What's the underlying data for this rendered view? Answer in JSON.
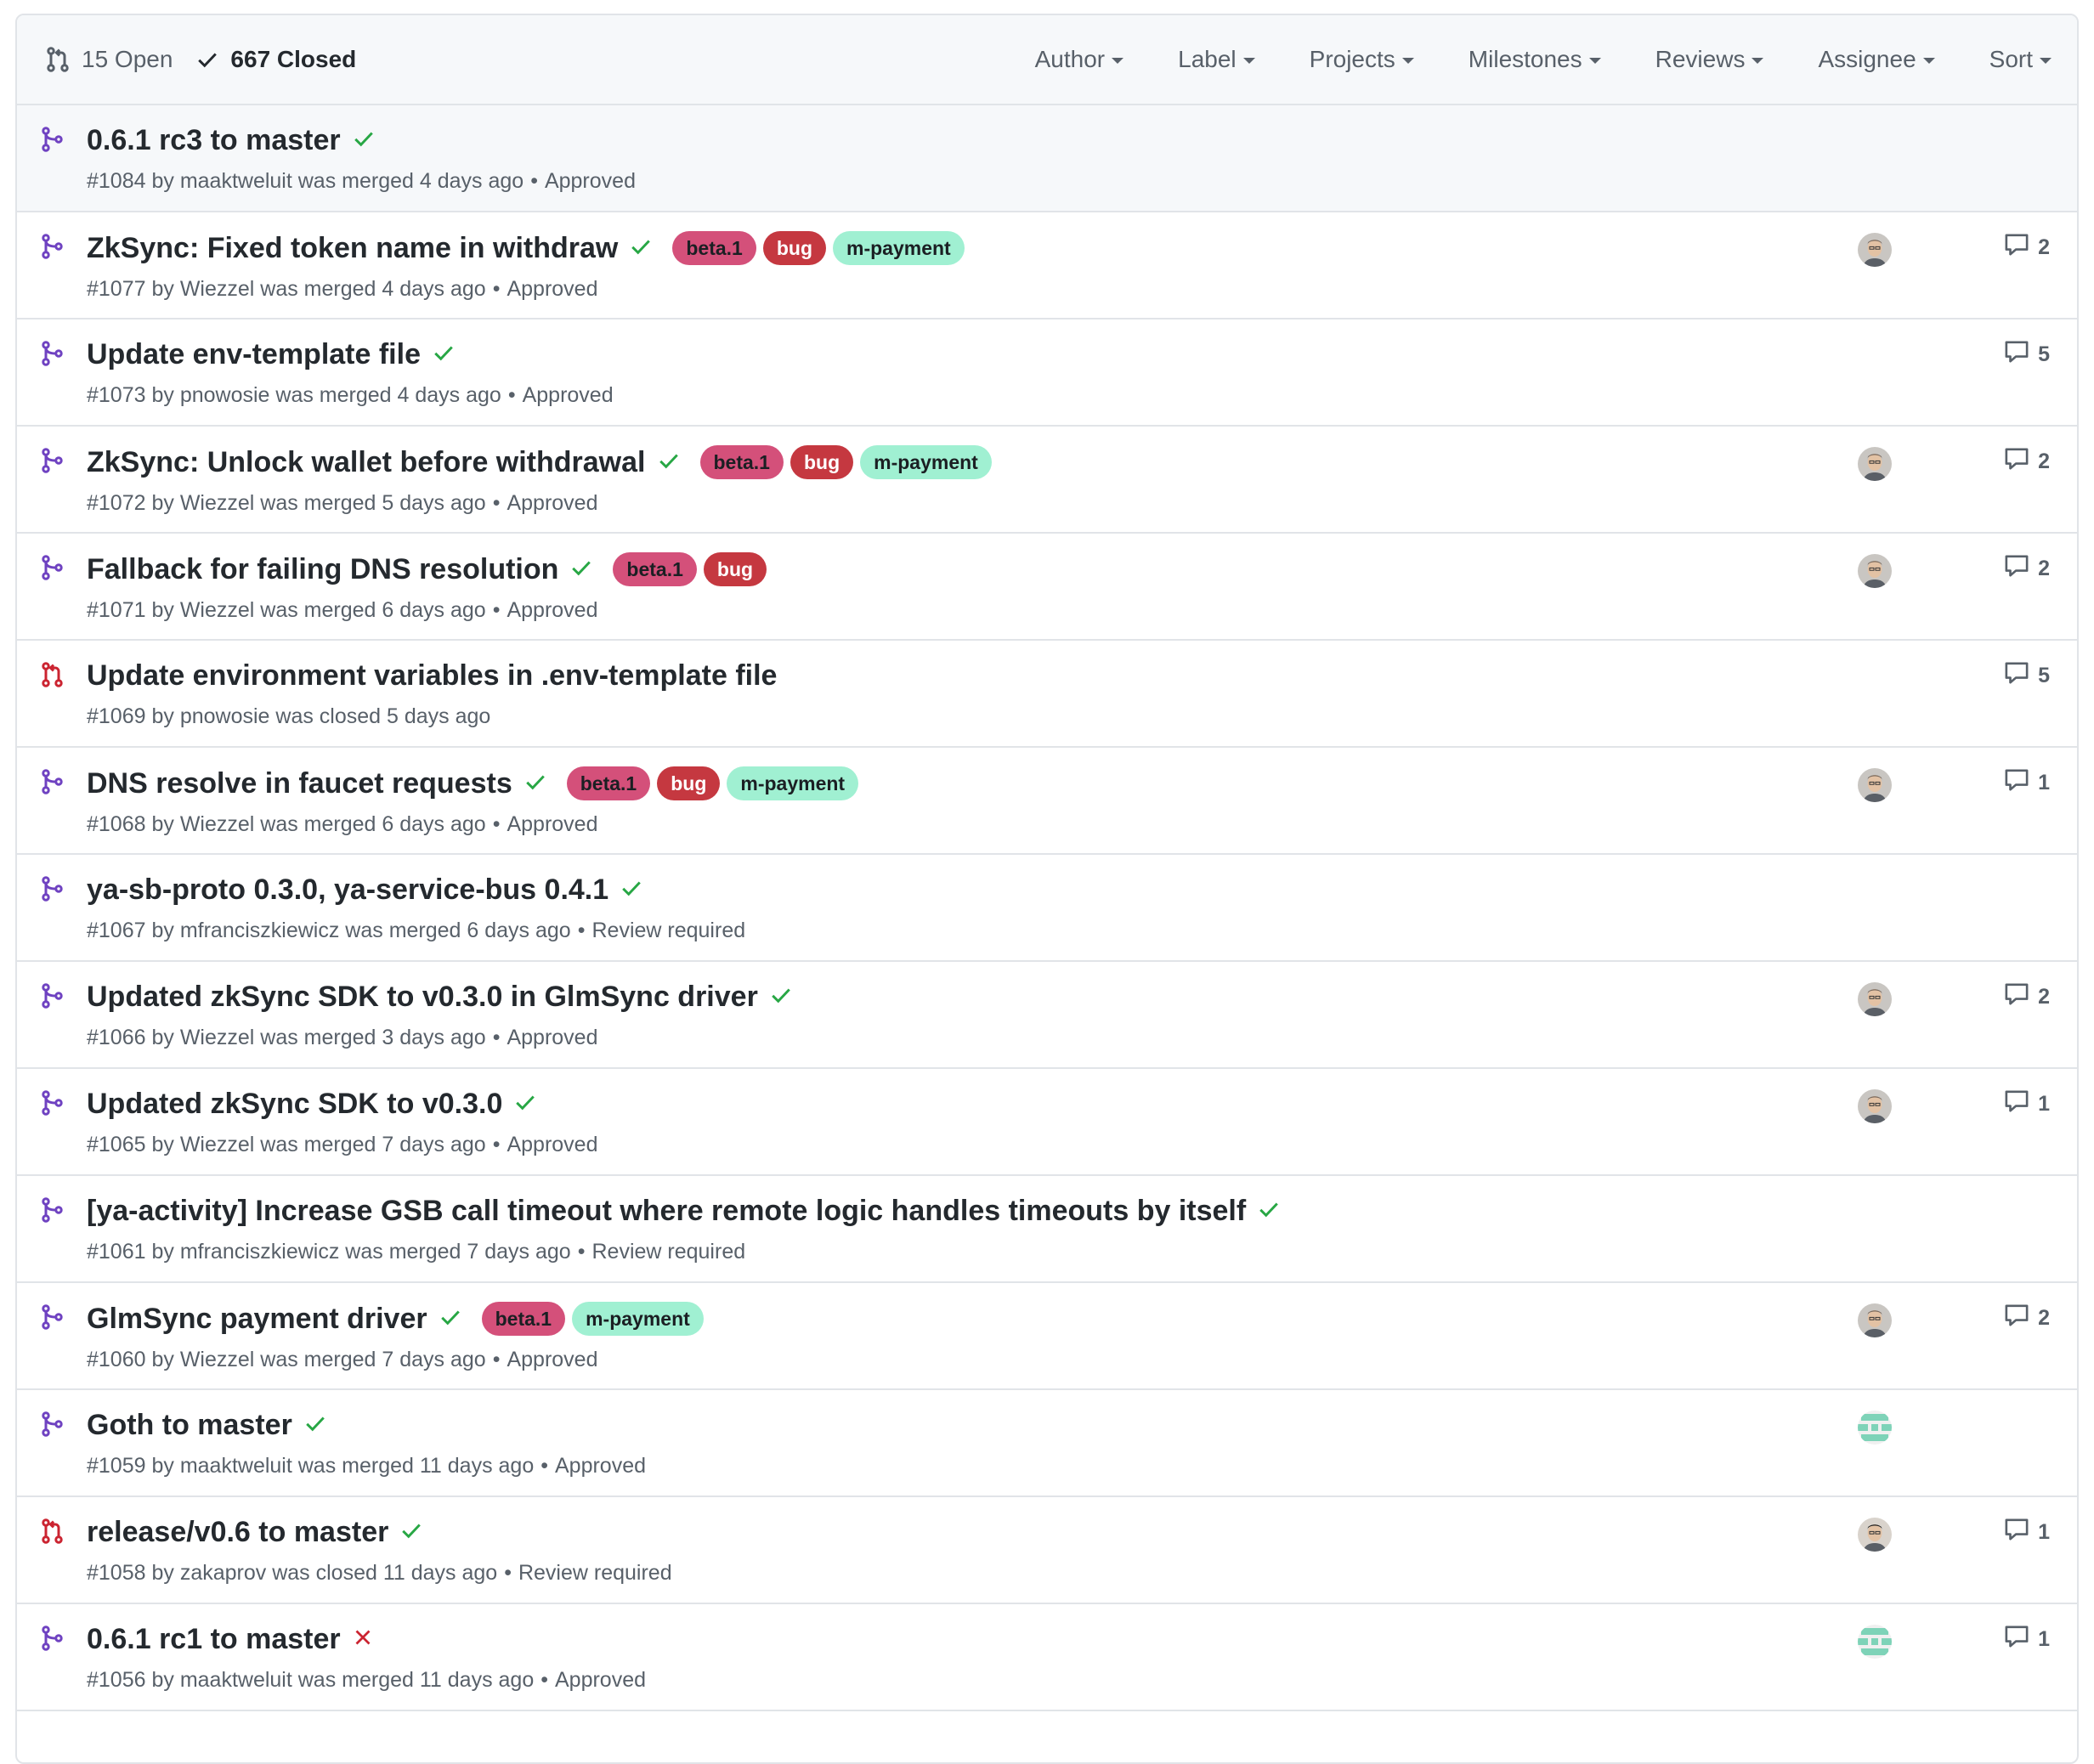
{
  "header": {
    "open_label": "15 Open",
    "closed_label": "667 Closed",
    "filters": [
      "Author",
      "Label",
      "Projects",
      "Milestones",
      "Reviews",
      "Assignee",
      "Sort"
    ]
  },
  "colors": {
    "merged": "#6f42c1",
    "closed": "#cb2431",
    "success": "#28a745",
    "failure": "#cb2431",
    "label_beta": "#d4507a",
    "label_bug": "#c53840",
    "label_payment": "#a0f0d2"
  },
  "pull_requests": [
    {
      "state": "merged",
      "title": "0.6.1 rc3 to master",
      "status": "success",
      "labels": [],
      "meta": "#1084 by maaktweluit was merged 4 days ago",
      "review": "Approved",
      "avatar": "",
      "comments": ""
    },
    {
      "state": "merged",
      "title": "ZkSync: Fixed token name in withdraw",
      "status": "success",
      "labels": [
        "beta.1",
        "bug",
        "m-payment"
      ],
      "meta": "#1077 by Wiezzel was merged 4 days ago",
      "review": "Approved",
      "avatar": "person",
      "comments": "2"
    },
    {
      "state": "merged",
      "title": "Update env-template file",
      "status": "success",
      "labels": [],
      "meta": "#1073 by pnowosie was merged 4 days ago",
      "review": "Approved",
      "avatar": "",
      "comments": "5"
    },
    {
      "state": "merged",
      "title": "ZkSync: Unlock wallet before withdrawal",
      "status": "success",
      "labels": [
        "beta.1",
        "bug",
        "m-payment"
      ],
      "meta": "#1072 by Wiezzel was merged 5 days ago",
      "review": "Approved",
      "avatar": "person",
      "comments": "2"
    },
    {
      "state": "merged",
      "title": "Fallback for failing DNS resolution",
      "status": "success",
      "labels": [
        "beta.1",
        "bug"
      ],
      "meta": "#1071 by Wiezzel was merged 6 days ago",
      "review": "Approved",
      "avatar": "person",
      "comments": "2"
    },
    {
      "state": "closed",
      "title": "Update environment variables in .env-template file",
      "status": "",
      "labels": [],
      "meta": "#1069 by pnowosie was closed 5 days ago",
      "review": "",
      "avatar": "",
      "comments": "5"
    },
    {
      "state": "merged",
      "title": "DNS resolve in faucet requests",
      "status": "success",
      "labels": [
        "beta.1",
        "bug",
        "m-payment"
      ],
      "meta": "#1068 by Wiezzel was merged 6 days ago",
      "review": "Approved",
      "avatar": "person",
      "comments": "1"
    },
    {
      "state": "merged",
      "title": "ya-sb-proto 0.3.0, ya-service-bus 0.4.1",
      "status": "success",
      "labels": [],
      "meta": "#1067 by mfranciszkiewicz was merged 6 days ago",
      "review": "Review required",
      "avatar": "",
      "comments": ""
    },
    {
      "state": "merged",
      "title": "Updated zkSync SDK to v0.3.0 in GlmSync driver",
      "status": "success",
      "labels": [],
      "meta": "#1066 by Wiezzel was merged 3 days ago",
      "review": "Approved",
      "avatar": "person",
      "comments": "2"
    },
    {
      "state": "merged",
      "title": "Updated zkSync SDK to v0.3.0",
      "status": "success",
      "labels": [],
      "meta": "#1065 by Wiezzel was merged 7 days ago",
      "review": "Approved",
      "avatar": "person",
      "comments": "1"
    },
    {
      "state": "merged",
      "title": "[ya-activity] Increase GSB call timeout where remote logic handles timeouts by itself",
      "status": "success",
      "labels": [],
      "meta": "#1061 by mfranciszkiewicz was merged 7 days ago",
      "review": "Review required",
      "avatar": "",
      "comments": ""
    },
    {
      "state": "merged",
      "title": "GlmSync payment driver",
      "status": "success",
      "labels": [
        "beta.1",
        "m-payment"
      ],
      "meta": "#1060 by Wiezzel was merged 7 days ago",
      "review": "Approved",
      "avatar": "person",
      "comments": "2"
    },
    {
      "state": "merged",
      "title": "Goth to master",
      "status": "success",
      "labels": [],
      "meta": "#1059 by maaktweluit was merged 11 days ago",
      "review": "Approved",
      "avatar": "identicon",
      "comments": ""
    },
    {
      "state": "closed",
      "title": "release/v0.6 to master",
      "status": "success",
      "labels": [],
      "meta": "#1058 by zakaprov was closed 11 days ago",
      "review": "Review required",
      "avatar": "person-dark",
      "comments": "1"
    },
    {
      "state": "merged",
      "title": "0.6.1 rc1 to master",
      "status": "failure",
      "labels": [],
      "meta": "#1056 by maaktweluit was merged 11 days ago",
      "review": "Approved",
      "avatar": "identicon",
      "comments": "1"
    }
  ]
}
